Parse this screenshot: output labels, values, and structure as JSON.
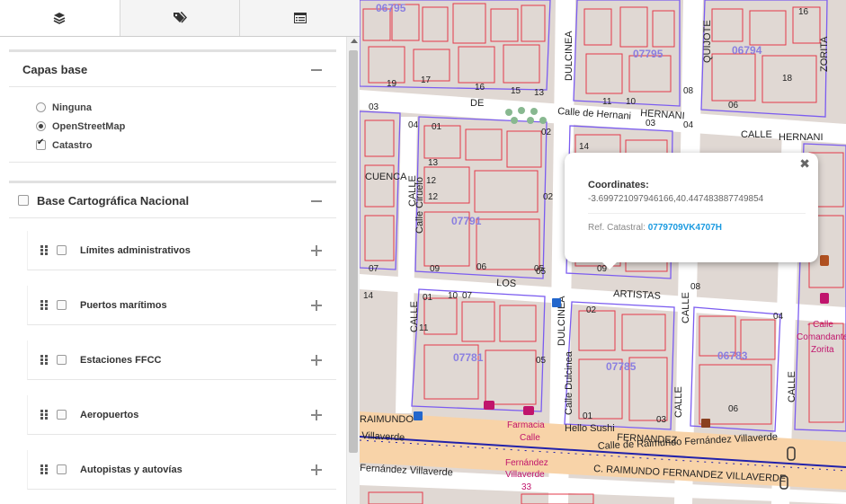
{
  "tabs": [
    {
      "name": "layers",
      "icon": "layers-icon"
    },
    {
      "name": "tags",
      "icon": "tags-icon"
    },
    {
      "name": "list",
      "icon": "list-icon"
    }
  ],
  "base_layers": {
    "title": "Capas base",
    "options": [
      {
        "label": "Ninguna",
        "checked": false
      },
      {
        "label": "OpenStreetMap",
        "checked": true
      },
      {
        "label": "Catastro",
        "checked": true
      }
    ]
  },
  "national": {
    "title": "Base Cartográfica Nacional",
    "layers": [
      {
        "label": "Límites administrativos"
      },
      {
        "label": "Puertos marítimos"
      },
      {
        "label": "Estaciones FFCC"
      },
      {
        "label": "Aeropuertos"
      },
      {
        "label": "Autopistas y autovías"
      }
    ]
  },
  "popup": {
    "title": "Coordinates:",
    "coords": "-3.699721097946166,40.447483887749854",
    "ref_label": "Ref. Catastral:",
    "ref_value": "0779709VK4707H",
    "close": "✖"
  },
  "map": {
    "street_labels": [
      {
        "text": "DE"
      },
      {
        "text": "Calle de Hernani"
      },
      {
        "text": "HERNANI"
      },
      {
        "text": "CALLE"
      },
      {
        "text": "HERNANI"
      },
      {
        "text": "DULCINEA"
      },
      {
        "text": "CUENCA"
      },
      {
        "text": "Calle Ciruelo"
      },
      {
        "text": "LOS"
      },
      {
        "text": "ARTISTAS"
      },
      {
        "text": "CALLE"
      },
      {
        "text": "DULCINEA"
      },
      {
        "text": "Calle Dulcinea"
      },
      {
        "text": "CALLE"
      },
      {
        "text": "FERNANDEZ"
      },
      {
        "text": "Calle de Raimundo Fernández Villaverde"
      },
      {
        "text": "C. RAIMUNDO FERNANDEZ VILLAVERDE"
      },
      {
        "text": "Villaverde"
      },
      {
        "text": "Fernández Villaverde"
      },
      {
        "text": "RAIMUNDO"
      },
      {
        "text": "CALLE"
      },
      {
        "text": "ZORITA"
      },
      {
        "text": "QUIJOTE"
      },
      {
        "text": "CALLE"
      },
      {
        "text": "CALLE"
      }
    ],
    "block_ids": [
      "06795",
      "07795",
      "06794",
      "07791",
      "07785",
      "06783",
      "07781"
    ],
    "poi_labels": [
      "Farmacia",
      "Calle",
      "Fernández",
      "Villaverde",
      "33",
      "Hello Sushi",
      "- Calle",
      "Comandante",
      "Zorita"
    ],
    "parcel_numbers": [
      "19",
      "17",
      "16",
      "15",
      "13",
      "11",
      "10",
      "08",
      "04",
      "03",
      "01",
      "02",
      "14",
      "12",
      "06",
      "07",
      "05",
      "09",
      "03",
      "04",
      "02",
      "01",
      "13",
      "12",
      "11",
      "10",
      "09",
      "08",
      "07",
      "06",
      "05",
      "14",
      "16",
      "18",
      "02",
      "04",
      "05",
      "06",
      "03",
      "01"
    ],
    "colors": {
      "parcel": "#e3394a",
      "block": "#7b5cf0",
      "road": "#ffffff",
      "main_road": "#f8d3a8",
      "rail": "#2222aa"
    }
  }
}
